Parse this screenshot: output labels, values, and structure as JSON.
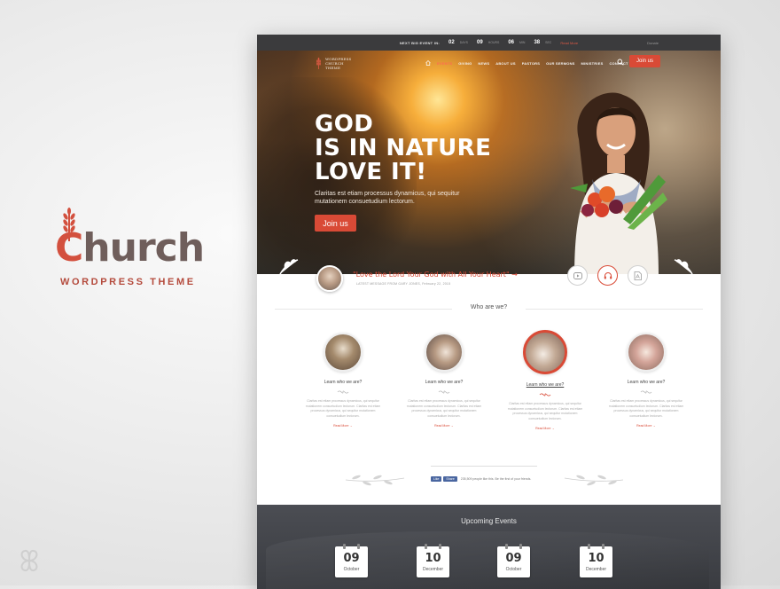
{
  "brand": {
    "title_first": "C",
    "title_rest": "hurch",
    "subtitle": "WORDPRESS  THEME"
  },
  "topbar": {
    "next_event_label": "NEXT BIG EVENT IN:",
    "countdown": [
      {
        "value": "02",
        "unit": "DAYS"
      },
      {
        "value": "09",
        "unit": "HOURS"
      },
      {
        "value": "06",
        "unit": "MIN"
      },
      {
        "value": "38",
        "unit": "SEC"
      }
    ],
    "link": "Read More",
    "right_text": "Donate"
  },
  "nav": {
    "logo_text": "WORDPRESS CHURCH THEME",
    "items": [
      "EVENTS",
      "GIVING",
      "NEWS",
      "ABOUT US",
      "PASTORS",
      "OUR SERMONS",
      "MINISTRIES",
      "CONNECT"
    ],
    "active_index": 0,
    "join_label": "Join us"
  },
  "hero": {
    "title_line1": "GOD",
    "title_line2": "IS IN NATURE",
    "title_line3": "LOVE IT!",
    "subtitle": "Claritas est etiam processus dynamicus, qui sequitur mutationem consuetudium lectorum.",
    "button_label": "Join us"
  },
  "quote": {
    "text": "\"Love the Lord Your God with All Your Heart\" →",
    "meta": "LATEST MESSAGE FROM GARY JONES, February 22, 2015"
  },
  "who": {
    "title": "Who are we?",
    "cards": [
      {
        "label": "Learn who we are?",
        "text": "Claritas est etiam processus dynamicus, qui sequitur mutationem consuetudium lectorum. Claritas est etiam processus dynamicus, qui sequitur mutationem consuetudium lectorum.",
        "more": "Read More →"
      },
      {
        "label": "Learn who we are?",
        "text": "Claritas est etiam processus dynamicus, qui sequitur mutationem consuetudium lectorum. Claritas est etiam processus dynamicus, qui sequitur mutationem consuetudium lectorum.",
        "more": "Read More →"
      },
      {
        "label": "Learn who we are?",
        "text": "Claritas est etiam processus dynamicus, qui sequitur mutationem consuetudium lectorum. Claritas est etiam processus dynamicus, qui sequitur mutationem consuetudium lectorum.",
        "more": "Read More →"
      },
      {
        "label": "Learn who we are?",
        "text": "Claritas est etiam processus dynamicus, qui sequitur mutationem consuetudium lectorum. Claritas est etiam processus dynamicus, qui sequitur mutationem consuetudium lectorum.",
        "more": "Read More →"
      }
    ]
  },
  "facebook": {
    "like": "Like",
    "share": "Share",
    "text": "235,509 people like this. Be the first of your friends."
  },
  "events": {
    "title": "Upcoming Events",
    "dates": [
      {
        "day": "09",
        "month": "October"
      },
      {
        "day": "10",
        "month": "December"
      },
      {
        "day": "09",
        "month": "October"
      },
      {
        "day": "10",
        "month": "December"
      }
    ]
  },
  "colors": {
    "accent": "#d94a36",
    "brand_brown": "#6f5e5b",
    "topbar": "#3b3b3d"
  }
}
